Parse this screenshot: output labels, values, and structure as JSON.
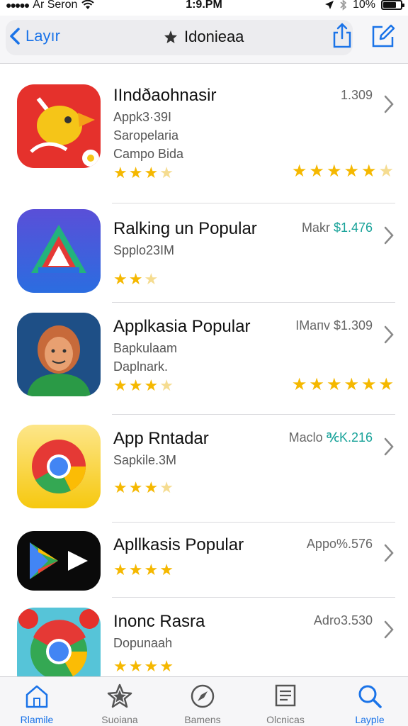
{
  "status_bar": {
    "carrier": "Ar Seron",
    "time": "1:9.PM",
    "battery": "10%"
  },
  "nav": {
    "back_label": "Layır",
    "title": "Idonieaa"
  },
  "apps": [
    {
      "name": "IIndðaohnasir",
      "sub1": "Appk3·39I",
      "sub2": "Saropelaria",
      "sub3": "Campo Bida",
      "price_text": "1.309",
      "price_accent": "",
      "rating": 3.5,
      "right_rating": 5.5
    },
    {
      "name": "Ralking un Popular",
      "sub1": "Spplo23IM",
      "sub2": "",
      "sub3": "",
      "price_text": "Makr ",
      "price_accent": "$1.476",
      "rating": 2.5,
      "right_rating": 0
    },
    {
      "name": "Applkasia Popular",
      "sub1": "Bapkulaam",
      "sub2": "Daplnark.",
      "sub3": "",
      "price_text": "IMaпv $1.309",
      "price_accent": "",
      "rating": 3.5,
      "right_rating": 6
    },
    {
      "name": "App Rntadar",
      "sub1": "Sapkile.3M",
      "sub2": "",
      "sub3": "",
      "price_text": "Maclo ",
      "price_accent": "℀K.216",
      "rating": 3.5,
      "right_rating": 0
    },
    {
      "name": "Apllkasis Popular",
      "sub1": "",
      "sub2": "",
      "sub3": "",
      "price_text": "Appo%.576",
      "price_accent": "",
      "rating": 4,
      "right_rating": 0
    },
    {
      "name": "Inonc Rasra",
      "sub1": "Dopunaah",
      "sub2": "",
      "sub3": "",
      "price_text": "Adro3.530",
      "price_accent": "",
      "rating": 4,
      "right_rating": 0
    }
  ],
  "tabs": [
    {
      "label": "Rlamile",
      "icon": "home-icon",
      "active": true
    },
    {
      "label": "Suoiana",
      "icon": "star-icon",
      "active": false
    },
    {
      "label": "Bamens",
      "icon": "compass-icon",
      "active": false
    },
    {
      "label": "Olcnicas",
      "icon": "list-icon",
      "active": false
    },
    {
      "label": "Layple",
      "icon": "search-icon",
      "active": true
    }
  ],
  "colors": {
    "accent": "#1a73e8",
    "star": "#f5b800",
    "price_accent": "#1aa39a"
  }
}
